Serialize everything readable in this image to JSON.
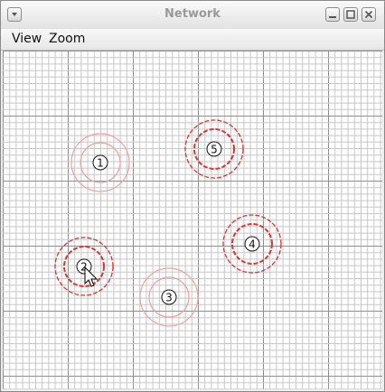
{
  "window": {
    "title": "Network"
  },
  "menu": {
    "items": [
      "View",
      "Zoom"
    ]
  },
  "nodes": [
    {
      "label": "1",
      "state": "idle",
      "ring_color": "#f0a0a0"
    },
    {
      "label": "2",
      "state": "active",
      "ring_color": "#e03030"
    },
    {
      "label": "3",
      "state": "idle",
      "ring_color": "#f0a0a0"
    },
    {
      "label": "4",
      "state": "active",
      "ring_color": "#e03030"
    },
    {
      "label": "5",
      "state": "active",
      "ring_color": "#e03030"
    }
  ],
  "colors": {
    "grid_minor": "#c7c7c7",
    "grid_major": "#8f8f8f",
    "title_text": "#9a9a9a"
  }
}
